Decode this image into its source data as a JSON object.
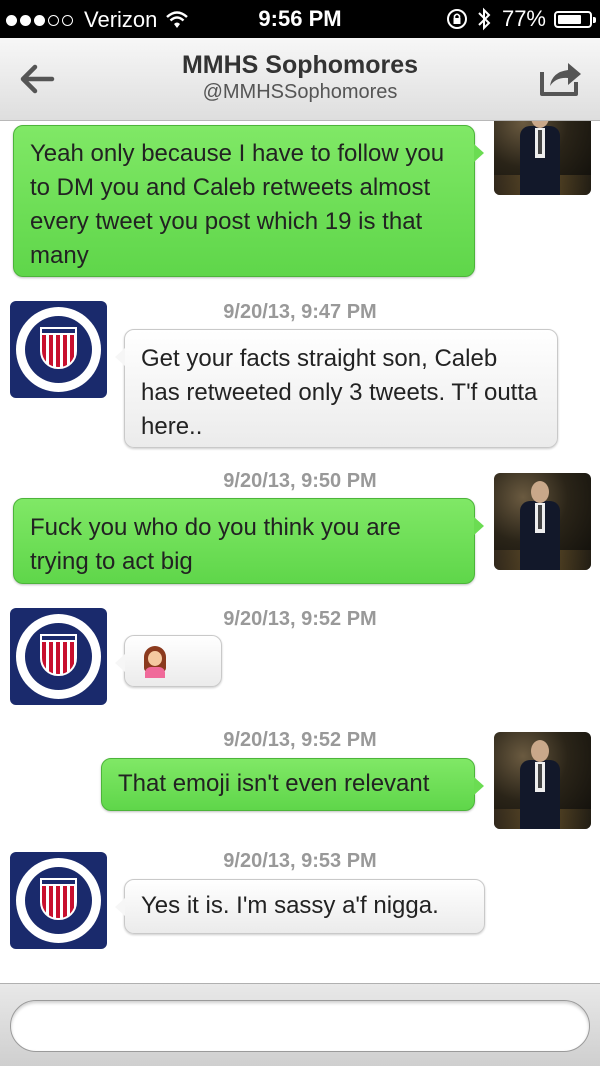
{
  "status_bar": {
    "carrier": "Verizon",
    "signal_bars_filled": 3,
    "signal_bars_total": 5,
    "time": "9:56 PM",
    "battery": "77%",
    "battery_level": 0.77
  },
  "nav": {
    "title": "MMHS Sophomores",
    "handle": "@MMHSSophomores"
  },
  "messages": [
    {
      "from": "me",
      "time": "",
      "text": "Yeah only because I have to follow you to DM you and Caleb retweets almost every tweet you post which 19 is that many"
    },
    {
      "from": "them",
      "time": "9/20/13, 9:47 PM",
      "text": "Get your facts straight son, Caleb has retweeted only 3 tweets. T'f outta here.."
    },
    {
      "from": "me",
      "time": "9/20/13, 9:50 PM",
      "text": "Fuck you who do you think you are trying to act big"
    },
    {
      "from": "them",
      "time": "9/20/13, 9:52 PM",
      "text": "",
      "emoji": "woman-tipping-hand-emoji"
    },
    {
      "from": "me",
      "time": "9/20/13, 9:52 PM",
      "text": "That emoji isn't even relevant"
    },
    {
      "from": "them",
      "time": "9/20/13, 9:53 PM",
      "text": "Yes it is. I'm sassy a'f nigga."
    }
  ],
  "input": {
    "placeholder": ""
  }
}
